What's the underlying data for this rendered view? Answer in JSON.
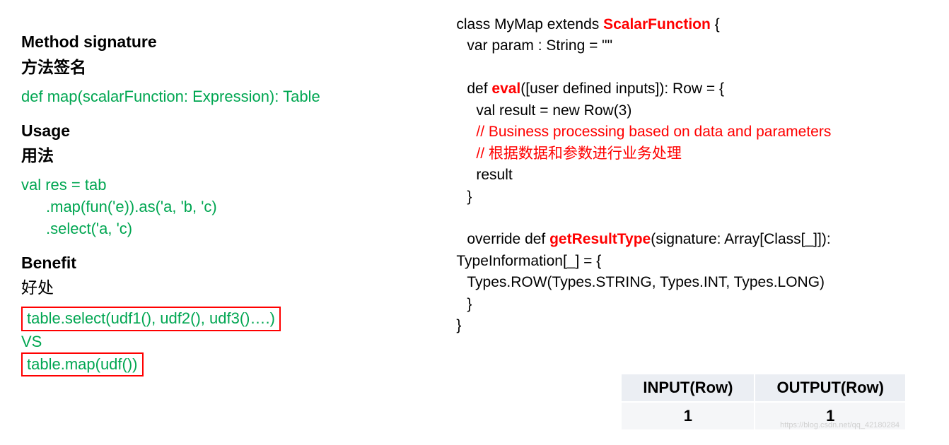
{
  "left": {
    "section1": {
      "title_en": "Method signature",
      "title_zh": "方法签名"
    },
    "signature_code": "def map(scalarFunction: Expression): Table",
    "section2": {
      "title_en": "Usage",
      "title_zh": "用法"
    },
    "usage_line1": "val res = tab",
    "usage_line2": ".map(fun('e)).as('a, 'b, 'c)",
    "usage_line3": ".select('a, 'c)",
    "section3": {
      "title_en": "Benefit",
      "title_zh": "好处"
    },
    "benefit_box1": "table.select(udf1(), udf2(), udf3()….)",
    "benefit_vs": "VS",
    "benefit_box2": "table.map(udf())"
  },
  "right": {
    "code": {
      "l1_pre": "class MyMap extends ",
      "l1_red": "ScalarFunction",
      "l1_post": " {",
      "l2": "var param : String = \"\"",
      "l3_pre": "def ",
      "l3_red": "eval",
      "l3_post": "([user defined inputs]): Row = {",
      "l4": "val result = new Row(3)",
      "l5": "// Business processing based on data and parameters",
      "l6": "// 根据数据和参数进行业务处理",
      "l7": "result",
      "l8": "}",
      "l9_pre": "override def ",
      "l9_red": "getResultType",
      "l9_post": "(signature: Array[Class[_]]):",
      "l10": "TypeInformation[_] = {",
      "l11": "Types.ROW(Types.STRING, Types.INT, Types.LONG)",
      "l12": "}",
      "l13": "}"
    },
    "table": {
      "head_input": "INPUT(Row)",
      "head_output": "OUTPUT(Row)",
      "val_input": "1",
      "val_output": "1"
    }
  },
  "watermark": "https://blog.csdn.net/qq_42180284"
}
